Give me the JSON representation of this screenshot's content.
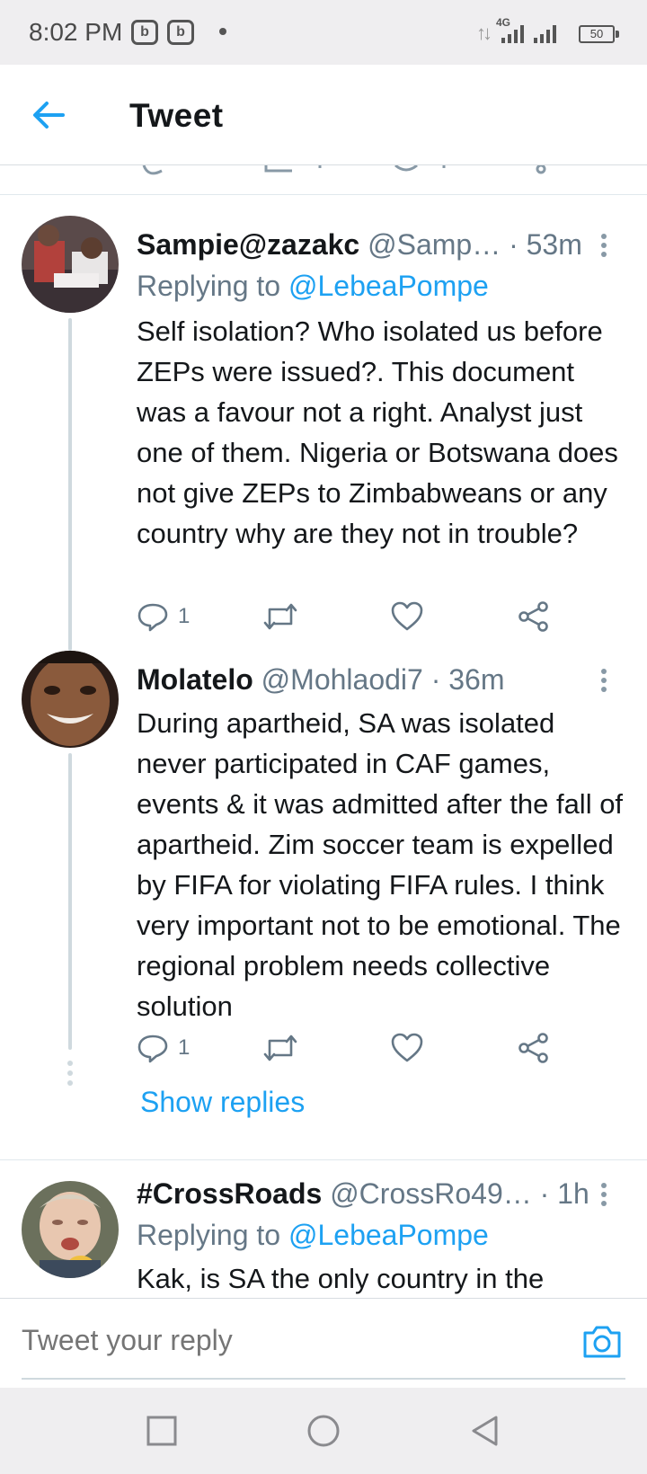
{
  "status_bar": {
    "time": "8:02 PM",
    "network": "4G",
    "battery": "50",
    "app_icon_1": "b",
    "app_icon_2": "b"
  },
  "header": {
    "title": "Tweet",
    "back_icon": "arrow-left-icon",
    "accent_color": "#1da1f2"
  },
  "tweets": [
    {
      "display_name": "Sampie@zazakc",
      "handle": "@Samp…",
      "time": "· 53m",
      "replying_prefix": "Replying to",
      "replying_to": "@LebeaPompe",
      "text": "Self isolation? Who isolated us before ZEPs were issued?. This document was a favour not a right. Analyst just one of them.  Nigeria or Botswana does not give ZEPs to Zimbabweans or any country why are they not in trouble?",
      "reply_count": "1"
    },
    {
      "display_name": "Molatelo",
      "handle": "@Mohlaodi7",
      "time": "· 36m",
      "text": "During apartheid, SA was isolated never participated in CAF games, events & it was admitted after the fall of apartheid. Zim soccer team is expelled by FIFA for violating FIFA rules. I think very important not to be emotional. The regional problem needs collective solution",
      "reply_count": "1",
      "show_replies": "Show replies"
    },
    {
      "display_name": "#CrossRoads",
      "handle": "@CrossRo49…",
      "time": "· 1h",
      "replying_prefix": "Replying to",
      "replying_to": "@LebeaPompe",
      "text": "Kak, is SA the only country in the"
    }
  ],
  "composer": {
    "placeholder": "Tweet your reply",
    "camera_icon": "camera-icon"
  },
  "nav": {
    "recents_icon": "square-icon",
    "home_icon": "circle-icon",
    "back_icon": "triangle-back-icon"
  }
}
